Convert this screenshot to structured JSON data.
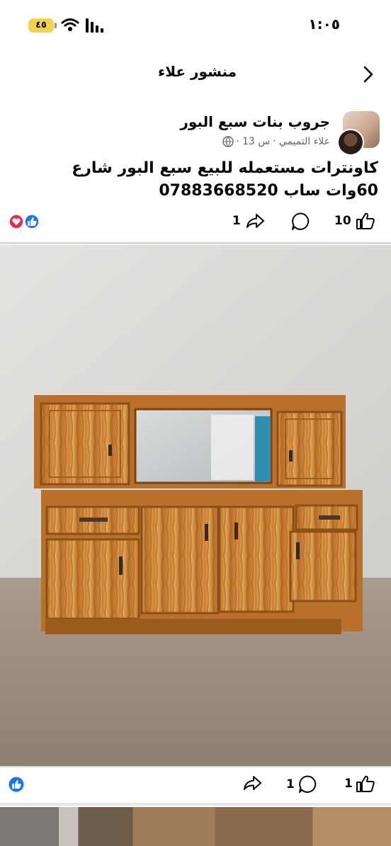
{
  "status_bar": {
    "time": "١:٠٥",
    "battery": "٤٥"
  },
  "header": {
    "title": "منشور علاء"
  },
  "post": {
    "group_name": "جروب بنات سبع البور",
    "author": "علاء التميمي",
    "separator": "·",
    "time": "13 س",
    "text_line1": "كاونترات مستعمله للبيع سبع البور شارع",
    "text_line2": "60وات ساب 07883668520",
    "likes": "10",
    "shares": "1"
  },
  "photo_bar": {
    "likes": "1",
    "comments": "1"
  },
  "colors": {
    "like_blue": "#1877f2",
    "love_red": "#f02849",
    "battery": "#f3d34a",
    "meta_gray": "#65676b"
  }
}
